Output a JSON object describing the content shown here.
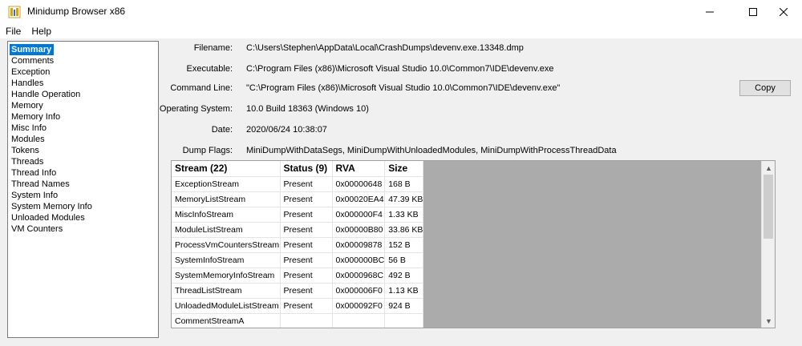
{
  "window": {
    "title": "Minidump Browser x86"
  },
  "menu": {
    "items": [
      "File",
      "Help"
    ]
  },
  "nav": {
    "items": [
      "Summary",
      "Comments",
      "Exception",
      "Handles",
      "Handle Operation",
      "Memory",
      "Memory Info",
      "Misc Info",
      "Modules",
      "Tokens",
      "Threads",
      "Thread Info",
      "Thread Names",
      "System Info",
      "System Memory Info",
      "Unloaded Modules",
      "VM Counters"
    ],
    "selected_index": 0
  },
  "summary": {
    "filename_label": "Filename:",
    "filename_value": "C:\\Users\\Stephen\\AppData\\Local\\CrashDumps\\devenv.exe.13348.dmp",
    "executable_label": "Executable:",
    "executable_value": "C:\\Program Files (x86)\\Microsoft Visual Studio 10.0\\Common7\\IDE\\devenv.exe",
    "cmdline_label": "Command Line:",
    "cmdline_value": "\"C:\\Program Files (x86)\\Microsoft Visual Studio 10.0\\Common7\\IDE\\devenv.exe\"",
    "os_label": "Operating System:",
    "os_value": "10.0 Build 18363 (Windows 10)",
    "date_label": "Date:",
    "date_value": "2020/06/24 10:38:07",
    "flags_label": "Dump Flags:",
    "flags_value": "MiniDumpWithDataSegs, MiniDumpWithUnloadedModules, MiniDumpWithProcessThreadData",
    "copy_label": "Copy"
  },
  "streams": {
    "headers": [
      "Stream (22)",
      "Status (9)",
      "RVA",
      "Size"
    ],
    "rows": [
      [
        "ExceptionStream",
        "Present",
        "0x00000648",
        "168 B"
      ],
      [
        "MemoryListStream",
        "Present",
        "0x00020EA4",
        "47.39 KB"
      ],
      [
        "MiscInfoStream",
        "Present",
        "0x000000F4",
        "1.33 KB"
      ],
      [
        "ModuleListStream",
        "Present",
        "0x00000B80",
        "33.86 KB"
      ],
      [
        "ProcessVmCountersStream",
        "Present",
        "0x00009878",
        "152 B"
      ],
      [
        "SystemInfoStream",
        "Present",
        "0x000000BC",
        "56 B"
      ],
      [
        "SystemMemoryInfoStream",
        "Present",
        "0x0000968C",
        "492 B"
      ],
      [
        "ThreadListStream",
        "Present",
        "0x000006F0",
        "1.13 KB"
      ],
      [
        "UnloadedModuleListStream",
        "Present",
        "0x000092F0",
        "924 B"
      ],
      [
        "CommentStreamA",
        "",
        "",
        ""
      ]
    ]
  },
  "colors": {
    "selection": "#0078d7",
    "grid_empty": "#ababab"
  }
}
